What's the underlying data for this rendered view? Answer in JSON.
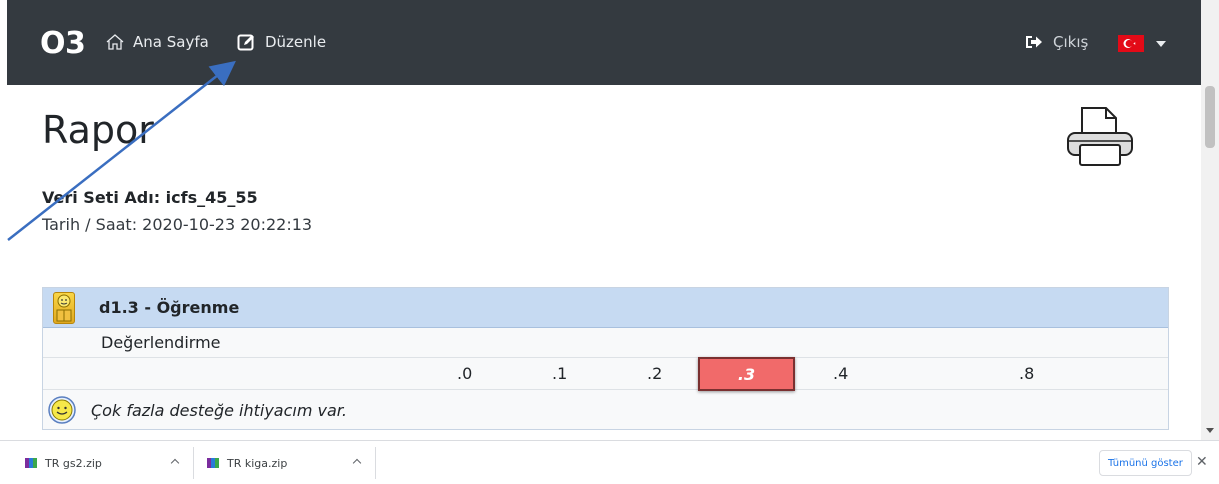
{
  "navbar": {
    "brand": "O3",
    "home_label": "Ana Sayfa",
    "edit_label": "Düzenle",
    "logout_label": "Çıkış",
    "language_flag": "tr-flag-icon"
  },
  "page": {
    "title": "Rapor",
    "dataset_label": "Veri Seti Adı: icfs_45_55",
    "datetime_label": "Tarih / Saat: 2020-10-23 20:22:13"
  },
  "assessment": {
    "code_title": "d1.3 - Öğrenme",
    "subheader": "Değerlendirme",
    "scale": [
      ".0",
      ".1",
      ".2",
      ".3",
      ".4",
      ".8"
    ],
    "selected": ".3",
    "answer": "Çok fazla desteğe ihtiyacım var.",
    "selected_color": "#f16a6a",
    "header_color": "#c6daf2"
  },
  "downloads": {
    "items": [
      "TR gs2.zip",
      "TR kiga.zip"
    ],
    "show_all_label": "Tümünü göster",
    "close_label": "✕"
  },
  "colors": {
    "navbar": "#343a40",
    "arrow": "#3a6ec0"
  }
}
